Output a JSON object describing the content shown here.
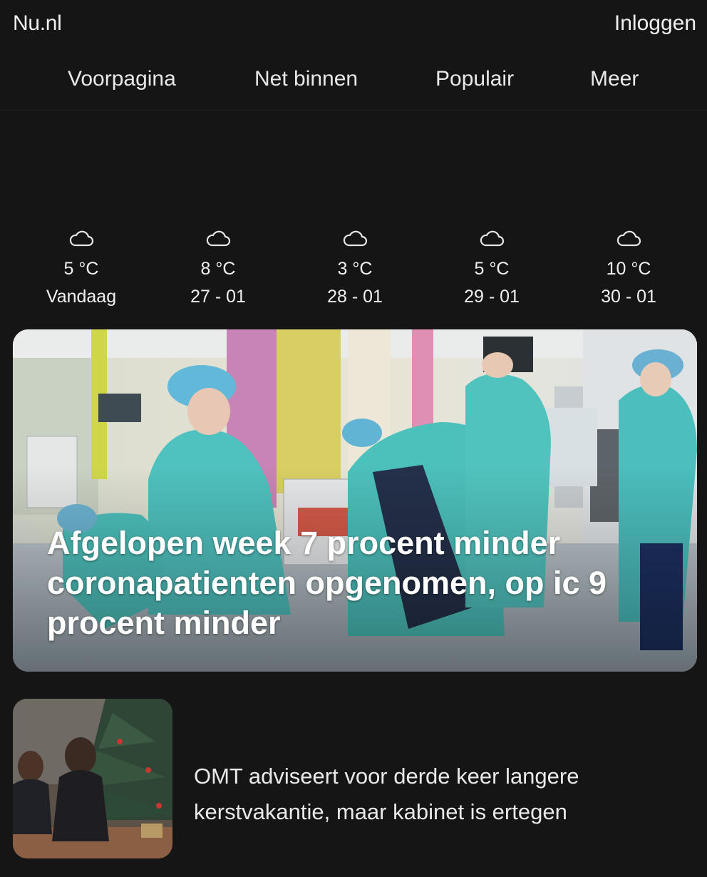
{
  "header": {
    "logo": "Nu.nl",
    "login_label": "Inloggen"
  },
  "nav": {
    "tabs": [
      {
        "label": "Voorpagina"
      },
      {
        "label": "Net binnen"
      },
      {
        "label": "Populair"
      },
      {
        "label": "Meer"
      }
    ]
  },
  "weather": {
    "days": [
      {
        "icon": "cloud-icon",
        "temp": "5 °C",
        "date": "Vandaag"
      },
      {
        "icon": "cloud-icon",
        "temp": "8 °C",
        "date": "27 - 01"
      },
      {
        "icon": "cloud-icon",
        "temp": "3 °C",
        "date": "28 - 01"
      },
      {
        "icon": "cloud-icon",
        "temp": "5 °C",
        "date": "29 - 01"
      },
      {
        "icon": "cloud-icon",
        "temp": "10 °C",
        "date": "30 - 01"
      }
    ]
  },
  "hero": {
    "title": "Afgelopen week 7 procent minder coronapatienten opgenomen, op ic 9 procent minder"
  },
  "articles": [
    {
      "title": "OMT adviseert voor derde keer langere kerstvakantie, maar kabinet is ertegen"
    }
  ],
  "colors": {
    "background": "#151515",
    "text": "#f0f0f0"
  }
}
